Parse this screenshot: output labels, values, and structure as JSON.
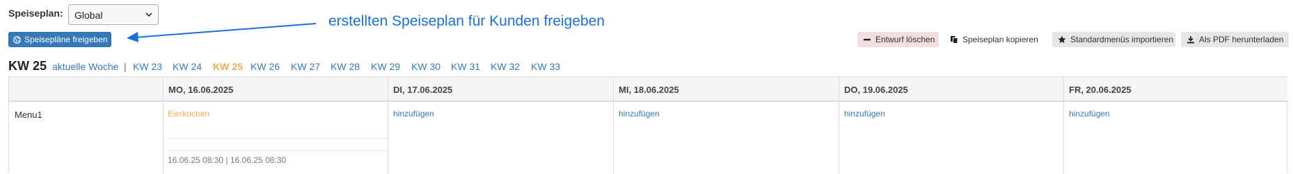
{
  "speiseplan": {
    "label": "Speiseplan:",
    "selected": "Global"
  },
  "actions": {
    "release_label": "Speisepläne freigeben",
    "delete_draft": "Entwurf löschen",
    "copy_plan": "Speiseplan kopieren",
    "import_defaults": "Standardmenüs importieren",
    "download_pdf": "Als PDF herunterladen"
  },
  "annotation": {
    "text": "erstellten Speiseplan für Kunden freigeben",
    "color": "#1a6fe0"
  },
  "weeks": {
    "current": "KW 25",
    "this_week_link": "aktuelle Woche",
    "separator": "|",
    "links": [
      "KW 23",
      "KW 24",
      "KW 25",
      "KW 26",
      "KW 27",
      "KW 28",
      "KW 29",
      "KW 30",
      "KW 31",
      "KW 32",
      "KW 33"
    ],
    "active": "KW 25"
  },
  "table": {
    "days": [
      "MO, 16.06.2025",
      "DI, 17.06.2025",
      "MI, 18.06.2025",
      "DO, 19.06.2025",
      "FR, 20.06.2025"
    ],
    "rows": [
      {
        "label": "Menu1",
        "cells": [
          {
            "meal": "Eierkuchen",
            "dates": "16.06.25 08:30 | 16.06.25 08:30"
          },
          {
            "add": "hinzufügen"
          },
          {
            "add": "hinzufügen"
          },
          {
            "add": "hinzufügen"
          },
          {
            "add": "hinzufügen"
          }
        ]
      }
    ]
  },
  "colors": {
    "primary": "#337ab7",
    "active_week": "#f0ad4e",
    "danger_bg": "#f2dede",
    "meal": "#f0ad4e"
  }
}
